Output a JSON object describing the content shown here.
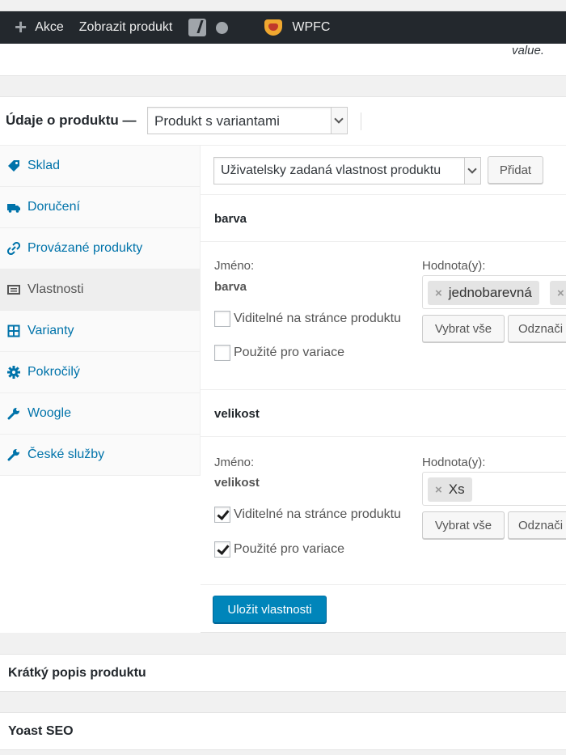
{
  "admin_bar": {
    "new_label": "Akce",
    "view_label": "Zobrazit produkt",
    "wpfc_label": "WPFC"
  },
  "description_tail": "value.",
  "product_data": {
    "title": "Údaje o produktu —",
    "product_type": "Produkt s variantami",
    "tabs": [
      {
        "label": "Sklad",
        "icon": "tag-icon"
      },
      {
        "label": "Doručení",
        "icon": "truck-icon"
      },
      {
        "label": "Provázané produkty",
        "icon": "link-icon"
      },
      {
        "label": "Vlastnosti",
        "icon": "list-icon",
        "active": true
      },
      {
        "label": "Varianty",
        "icon": "grid-icon"
      },
      {
        "label": "Pokročilý",
        "icon": "gear-icon"
      },
      {
        "label": "Woogle",
        "icon": "wrench-icon"
      },
      {
        "label": "České služby",
        "icon": "wrench-icon"
      }
    ],
    "attribute_select": "Uživatelsky zadaná vlastnost produktu",
    "add_button": "Přidat",
    "attributes": [
      {
        "header": "barva",
        "name_label": "Jméno:",
        "name_value": "barva",
        "values_label": "Hodnota(y):",
        "tags": [
          "jednobarevná"
        ],
        "visible_label": "Viditelné na stránce produktu",
        "visible_checked": false,
        "variation_label": "Použité pro variace",
        "variation_checked": false,
        "select_all": "Vybrat vše",
        "deselect": "Odznači"
      },
      {
        "header": "velikost",
        "name_label": "Jméno:",
        "name_value": "velikost",
        "values_label": "Hodnota(y):",
        "tags": [
          "Xs"
        ],
        "visible_label": "Viditelné na stránce produktu",
        "visible_checked": true,
        "variation_label": "Použité pro variace",
        "variation_checked": true,
        "select_all": "Vybrat vše",
        "deselect": "Odznači"
      }
    ],
    "save_button": "Uložit vlastnosti"
  },
  "short_description_title": "Krátký popis produktu",
  "yoast_title": "Yoast SEO"
}
